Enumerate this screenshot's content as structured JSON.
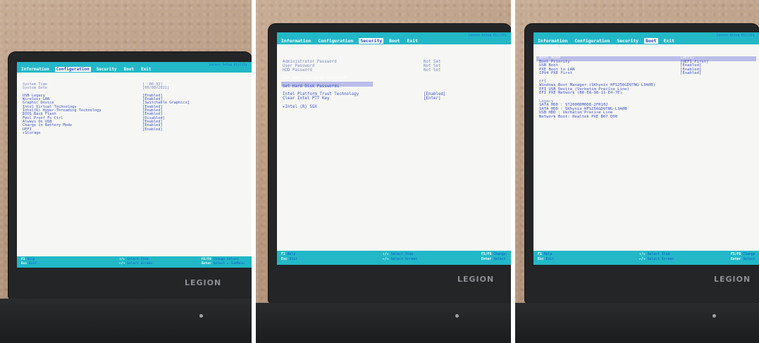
{
  "photos": [
    {
      "title": "Lenovo Setup Utility",
      "tabs": [
        {
          "label": "Information",
          "active": false
        },
        {
          "label": "Configuration",
          "active": true
        },
        {
          "label": "Security",
          "active": false
        },
        {
          "label": "Boot",
          "active": false
        },
        {
          "label": "Exit",
          "active": false
        }
      ],
      "rows": [
        {
          "label": "System Time",
          "value": "[  :06:32]",
          "style": "dim"
        },
        {
          "label": "System Date",
          "value": "[06/08/2021]",
          "style": "dim"
        },
        {
          "label": "",
          "value": "",
          "style": ""
        },
        {
          "label": "USB Legacy",
          "value": "[Enabled]",
          "style": ""
        },
        {
          "label": "Wireless LAN",
          "value": "[Enabled]",
          "style": ""
        },
        {
          "label": "Graphic Device",
          "value": "[Switchable Graphics]",
          "style": ""
        },
        {
          "label": "Intel Virtual Technology",
          "value": "[Enabled]",
          "style": ""
        },
        {
          "label": "Intel(R) Hyper-Threading Technology",
          "value": "[Enabled]",
          "style": ""
        },
        {
          "label": "BIOS Back Flash",
          "value": "[Enabled]",
          "style": ""
        },
        {
          "label": "Fool Proof Fn Ctrl",
          "value": "[Disabled]",
          "style": ""
        },
        {
          "label": "Always On USB",
          "value": "[Enabled]",
          "style": ""
        },
        {
          "label": "Charge in Battery Mode",
          "value": "[Enabled]",
          "style": ""
        },
        {
          "label": "UEFI",
          "value": "[Enabled]",
          "style": ""
        },
        {
          "label": "▸Storage",
          "value": "",
          "style": ""
        }
      ],
      "footer": [
        {
          "key": "F1",
          "desc": "Help"
        },
        {
          "key": "Esc",
          "desc": "Exit"
        },
        {
          "key": "↑/↓",
          "desc": "Select Item"
        },
        {
          "key": "←/→",
          "desc": "Select Screen"
        },
        {
          "key": "F5/F6",
          "desc": "Change Values"
        },
        {
          "key": "Enter",
          "desc": "Select ▸ SubMenu"
        }
      ],
      "logo": "LEGION"
    },
    {
      "title": "Lenovo Setup Utility",
      "tabs": [
        {
          "label": "Information",
          "active": false
        },
        {
          "label": "Configuration",
          "active": false
        },
        {
          "label": "Security",
          "active": true
        },
        {
          "label": "Boot",
          "active": false
        },
        {
          "label": "Exit",
          "active": false
        }
      ],
      "rows": [
        {
          "label": "Administrator Password",
          "value": "Not Set",
          "style": "dim"
        },
        {
          "label": "User Password",
          "value": "Not Set",
          "style": "dim"
        },
        {
          "label": "HDD Password",
          "value": "Not Set",
          "style": "dim"
        },
        {
          "label": "",
          "value": "",
          "style": ""
        },
        {
          "label": "Set Administrator Password",
          "value": "",
          "style": "hl"
        },
        {
          "label": "",
          "value": "",
          "style": ""
        },
        {
          "label": "Set Hard Disk Passwords",
          "value": "",
          "style": ""
        },
        {
          "label": "",
          "value": "",
          "style": ""
        },
        {
          "label": "Intel Platform Trust Technology",
          "value": "[Enabled]",
          "style": ""
        },
        {
          "label": "Clear Intel PTT Key",
          "value": "[Enter]",
          "style": ""
        },
        {
          "label": "",
          "value": "",
          "style": ""
        },
        {
          "label": "▸Intel (R) SGX",
          "value": "",
          "style": ""
        }
      ],
      "footer": [
        {
          "key": "F1",
          "desc": "Help"
        },
        {
          "key": "Esc",
          "desc": "Exit"
        },
        {
          "key": "↑/↓",
          "desc": "Select Item"
        },
        {
          "key": "←/→",
          "desc": "Select Screen"
        },
        {
          "key": "F5/F6",
          "desc": "Change"
        },
        {
          "key": "Enter",
          "desc": "Select"
        }
      ],
      "logo": "LEGION"
    },
    {
      "title": "Lenovo Setup Utility",
      "tabs": [
        {
          "label": "Information",
          "active": false
        },
        {
          "label": "Configuration",
          "active": false
        },
        {
          "label": "Security",
          "active": false
        },
        {
          "label": "Boot",
          "active": true
        },
        {
          "label": "Exit",
          "active": false
        }
      ],
      "rows": [
        {
          "label": "Boot Mode",
          "value": "[UEFI]",
          "style": "hl"
        },
        {
          "label": "Boot Priority",
          "value": "[UEFI First]",
          "style": ""
        },
        {
          "label": "USB Boot",
          "value": "[Enabled]",
          "style": ""
        },
        {
          "label": "PXE Boot to LAN",
          "value": "[Enabled]",
          "style": ""
        },
        {
          "label": "IPV4 PXE First",
          "value": "[Enabled]",
          "style": ""
        },
        {
          "label": "",
          "value": "",
          "style": ""
        },
        {
          "label": "EFI",
          "value": "",
          "style": "dim"
        },
        {
          "label": "Windows Boot Manager (SKhynix_HFS256GD9TNG-L3A0B)",
          "value": "",
          "style": ""
        },
        {
          "label": "EFI USB Device (Verbatim Precise Line)",
          "value": "",
          "style": ""
        },
        {
          "label": "EFI PXE Network (B8-EA-98-11-E4-7E)",
          "value": "",
          "style": ""
        },
        {
          "label": "",
          "value": "",
          "style": ""
        },
        {
          "label": "Legacy",
          "value": "",
          "style": "dim"
        },
        {
          "label": "SATA HDD    : ST2000DM008-2FR102",
          "value": "",
          "style": ""
        },
        {
          "label": "SATA HDD    : SKhynix_HFS256GD9TNG-L3A0B",
          "value": "",
          "style": ""
        },
        {
          "label": "USB HDD     : Verbatim Precise Line",
          "value": "",
          "style": ""
        },
        {
          "label": "Network Boot: Realtek PXE B07 D00",
          "value": "",
          "style": ""
        }
      ],
      "footer": [
        {
          "key": "F1",
          "desc": "Help"
        },
        {
          "key": "Esc",
          "desc": "Exit"
        },
        {
          "key": "↑/↓",
          "desc": "Select Item"
        },
        {
          "key": "←/→",
          "desc": "Select Screen"
        },
        {
          "key": "F5/F6",
          "desc": "Change"
        },
        {
          "key": "Enter",
          "desc": "Select"
        }
      ],
      "logo": "LEGION"
    }
  ]
}
